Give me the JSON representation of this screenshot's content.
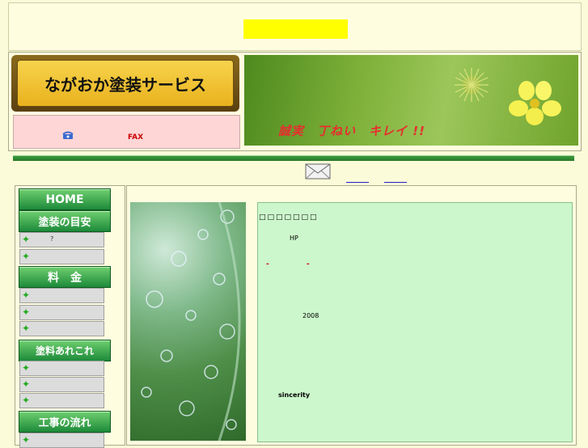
{
  "header": {
    "logo_text": "ながおか塗装サービス",
    "fax_label": "FAX",
    "tagline": "誠実　丁ねい　キレイ !!"
  },
  "nav": {
    "home": "HOME",
    "section1": "塗装の目安",
    "section1_item1_mark": "?",
    "section2": "料　金",
    "section3": "塗料あれこれ",
    "section4": "工事の流れ"
  },
  "content": {
    "title": "□□□□□□□",
    "hp": "HP",
    "mark1": "-",
    "mark2": "-",
    "year": "2008",
    "sincerity": "sincerity"
  },
  "colors": {
    "accent_green": "#1d8a3a",
    "highlight_yellow": "#ffff00",
    "contact_pink": "#ffd6d6",
    "content_green": "#ccf7cc",
    "tagline_red": "#e62e2e"
  },
  "icons": [
    "phone-icon",
    "mail-icon",
    "star-icon",
    "flower-icon"
  ]
}
